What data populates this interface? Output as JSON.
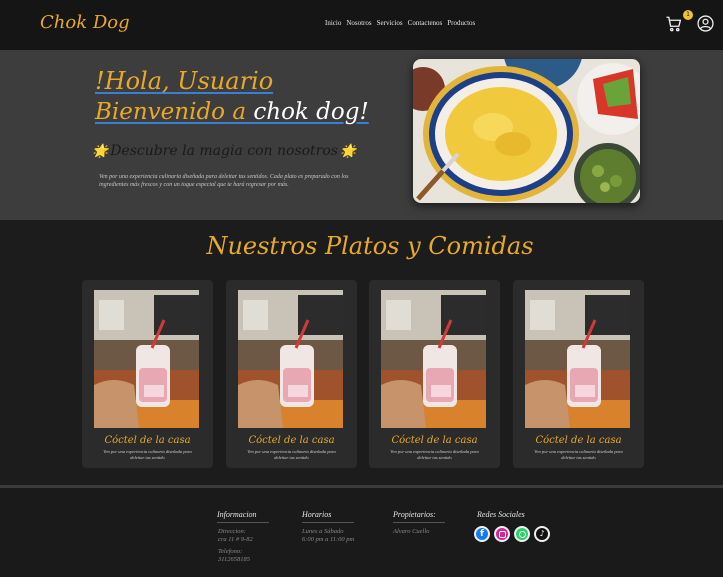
{
  "brand": "Chok Dog",
  "nav": {
    "items": [
      "Inicio",
      "Nosotros",
      "Servicios",
      "Contactenos",
      "Productos"
    ]
  },
  "cart": {
    "count": "1"
  },
  "hero": {
    "greeting": "!Hola, Usuario",
    "welcome_prefix": "Bienvenido a ",
    "welcome_name": "chok dog!",
    "tagline": "Descubre la magia con nosotros",
    "description": "Ven por una experiencia culinaria diseñada para deleitar tus sentidos. Cada plato es preparado con los ingredientes más frescos y con un toque especial que te hará regresar por más."
  },
  "section": {
    "title": "Nuestros Platos y Comidas"
  },
  "cards": [
    {
      "title": "Cóctel de la casa",
      "desc": "Ven por una experiencia culinaria diseñada para deleitar tus sentido"
    },
    {
      "title": "Cóctel de la casa",
      "desc": "Ven por una experiencia culinaria diseñada para deleitar tus sentido"
    },
    {
      "title": "Cóctel de la casa",
      "desc": "Ven por una experiencia culinaria diseñada para deleitar tus sentido"
    },
    {
      "title": "Cóctel de la casa",
      "desc": "Ven por una experiencia culinaria diseñada para deleitar tus sentido"
    }
  ],
  "footer": {
    "info_title": "Informacion",
    "address_label": "Direccion:",
    "address": "cra 11 # 9-82",
    "phone_label": "Telefono:",
    "phone": "3112658185",
    "hours_title": "Horarios",
    "hours_days": "Lunes a Sábado",
    "hours_time": "6:00 pm a 11:00 pm",
    "owners_title": "Propietarios:",
    "owner": "Alvaro Cuello",
    "social_title": "Redes Sociales",
    "social_icons": [
      "facebook-icon",
      "instagram-icon",
      "whatsapp-icon",
      "tiktok-icon"
    ]
  },
  "colors": {
    "accent": "#e9a928",
    "nav_bg": "#151515",
    "hero_bg": "#3d3d3d",
    "body_bg": "#1c1c1c",
    "card_bg": "#2b2b2b",
    "underline": "#3b7fd4"
  }
}
